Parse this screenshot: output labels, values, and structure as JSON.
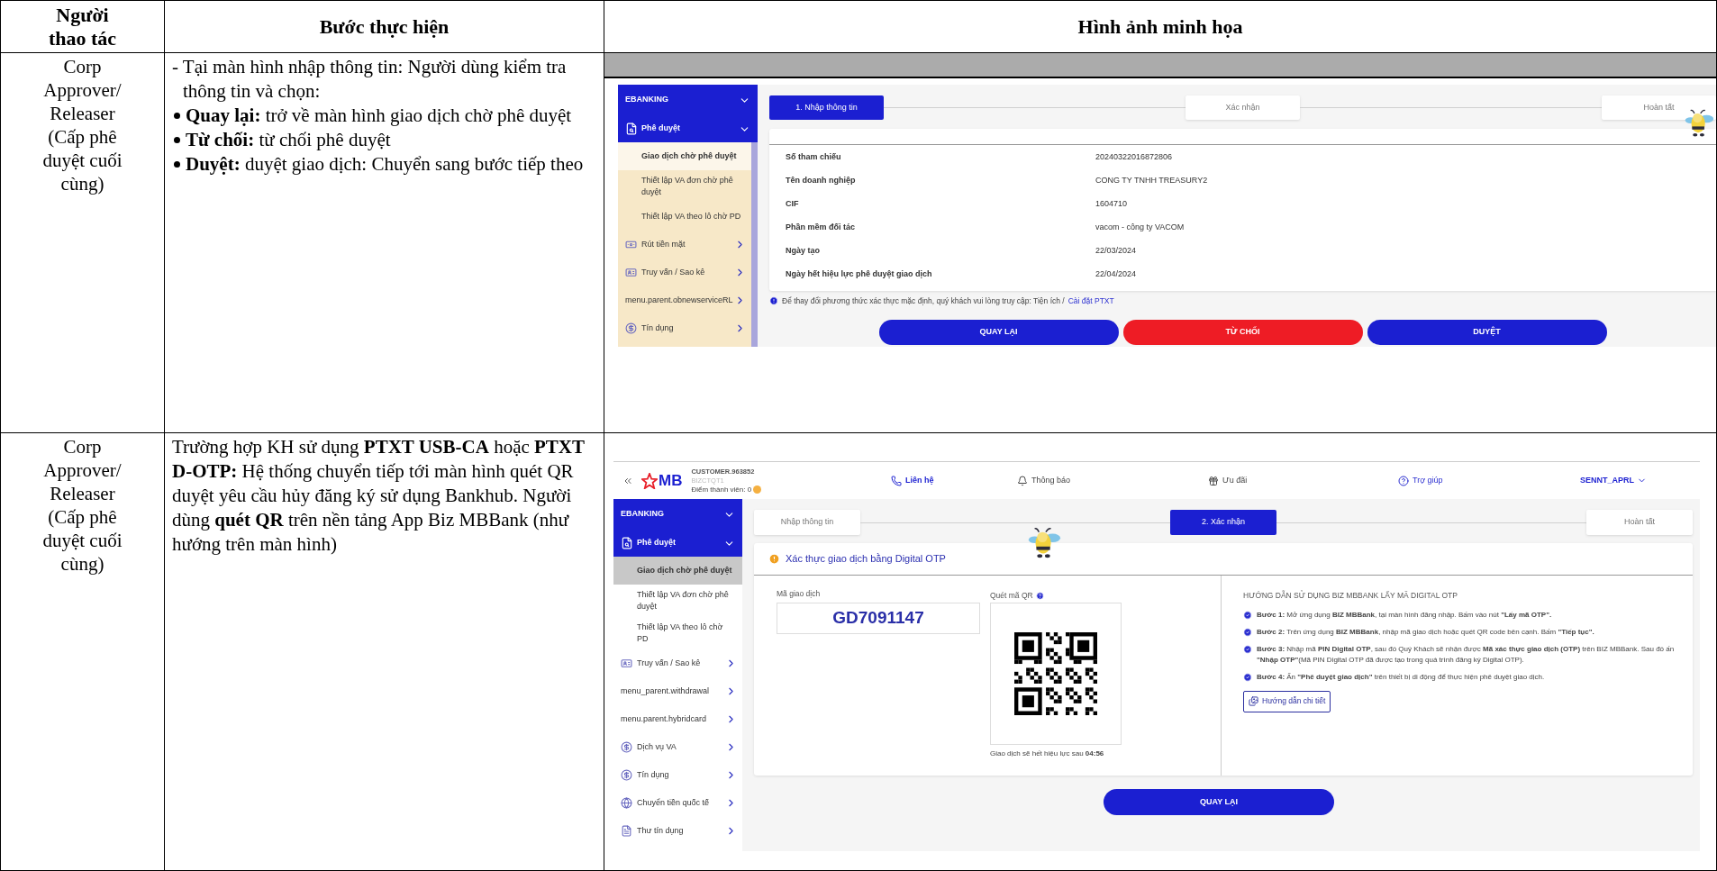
{
  "table": {
    "columns": [
      "Người thao tác",
      "Bước thực hiện",
      "Hình ảnh minh họa"
    ],
    "rows": [
      {
        "actor": "Corp Approver/ Releaser (Cấp phê duyệt cuối cùng)",
        "steps": {
          "intro": "- Tại màn hình nhập thông tin: Người dùng kiểm tra thông tin và chọn:",
          "bullets": [
            "**Quay lại:** trở về màn hình giao dịch chờ phê duyệt",
            "**Từ chối:** từ chối phê duyệt",
            "**Duyệt:** duyệt giao dịch: Chuyển sang bước tiếp theo"
          ]
        },
        "screenshot": {
          "kind": "review",
          "sidebar": {
            "section": "EBANKING",
            "group": "Phê duyệt",
            "items": [
              {
                "label": "Giao dịch chờ phê duyệt",
                "kind": "sub",
                "selected": true
              },
              {
                "label": "Thiết lập VA đơn chờ phê duyệt",
                "kind": "sub",
                "selected": false
              },
              {
                "label": "Thiết lập VA theo lô chờ PD",
                "kind": "sub",
                "selected": false
              },
              {
                "label": "Rút tiền mặt",
                "kind": "menu",
                "selected": false
              },
              {
                "label": "Truy vấn / Sao kê",
                "kind": "menu",
                "selected": false
              },
              {
                "label": "menu.parent.obnewserviceRL",
                "kind": "plain",
                "selected": false
              },
              {
                "label": "Tín dụng",
                "kind": "menu",
                "selected": false
              }
            ]
          },
          "stepper": [
            {
              "label": "1. Nhập thông tin",
              "selected": true
            },
            {
              "label": "Xác nhận",
              "selected": false
            },
            {
              "label": "Hoàn tất",
              "selected": false
            }
          ],
          "details": [
            {
              "label": "Số tham chiếu",
              "value": "20240322016872806"
            },
            {
              "label": "Tên doanh nghiệp",
              "value": "CONG TY TNHH TREASURY2"
            },
            {
              "label": "CIF",
              "value": "1604710"
            },
            {
              "label": "Phần mềm đối tác",
              "value": "vacom - công ty VACOM"
            },
            {
              "label": "Ngày tạo",
              "value": "22/03/2024"
            },
            {
              "label": "Ngày hết hiệu lực phê duyệt giao dịch",
              "value": "22/04/2024"
            }
          ],
          "note": {
            "text": "Để thay đổi phương thức xác thực mặc định, quý khách vui lòng truy cập: Tiện ích /",
            "link": "Cài đặt PTXT"
          },
          "buttons": [
            {
              "label": "QUAY LẠI",
              "kind": "primary"
            },
            {
              "label": "TỪ CHỐI",
              "kind": "danger"
            },
            {
              "label": "DUYỆT",
              "kind": "primary"
            }
          ]
        }
      },
      {
        "actor": "Corp Approver/ Releaser (Cấp phê duyệt cuối cùng)",
        "steps": {
          "paragraph": "Trường hợp KH sử dụng **PTXT USB-CA** hoặc **PTXT D-OTP:** Hệ thống chuyển tiếp tới màn hình quét QR duyệt yêu cầu hủy đăng ký sử dụng Bankhub. Người dùng **quét QR** trên nền tảng App Biz MBBank (như hướng trên màn hình)"
        },
        "screenshot": {
          "kind": "otp",
          "header": {
            "logo": "MB",
            "customer": "CUSTOMER.963852",
            "company": "BIZCTQT1",
            "points": "Điểm thành viên: 0",
            "nav": [
              {
                "label": "Liên hệ",
                "kind": "contact"
              },
              {
                "label": "Thông báo",
                "kind": "notifications"
              },
              {
                "label": "Ưu đãi",
                "kind": "offers"
              },
              {
                "label": "Trợ giúp",
                "kind": "help"
              }
            ],
            "user": "SENNT_APRL"
          },
          "sidebar": {
            "section": "EBANKING",
            "group": "Phê duyệt",
            "items": [
              {
                "label": "Giao dịch chờ phê duyệt",
                "kind": "sub",
                "selected": true
              },
              {
                "label": "Thiết lập VA đơn chờ phê duyệt",
                "kind": "sub",
                "selected": false
              },
              {
                "label": "Thiết lập VA theo lô chờ PD",
                "kind": "sub",
                "selected": false
              },
              {
                "label": "Truy vấn / Sao kê",
                "kind": "menu",
                "selected": false
              },
              {
                "label": "menu_parent.withdrawal",
                "kind": "plain",
                "selected": false
              },
              {
                "label": "menu.parent.hybridcard",
                "kind": "plain",
                "selected": false
              },
              {
                "label": "Dịch vụ VA",
                "kind": "menu",
                "selected": false
              },
              {
                "label": "Tín dụng",
                "kind": "menu",
                "selected": false
              },
              {
                "label": "Chuyển tiền quốc tế",
                "kind": "menu",
                "selected": false
              },
              {
                "label": "Thư tín dụng",
                "kind": "menu",
                "selected": false
              }
            ]
          },
          "stepper": [
            {
              "label": "Nhập thông tin",
              "selected": false
            },
            {
              "label": "2. Xác nhận",
              "selected": true
            },
            {
              "label": "Hoàn tất",
              "selected": false
            }
          ],
          "card": {
            "title": "Xác thực giao dịch bằng Digital OTP",
            "code_label": "Mã giao dịch",
            "code": "GD7091147",
            "qr_label": "Quét mã QR",
            "expiry": "Giao dịch sẽ hết hiệu lực sau **04:56**",
            "guide_title": "HƯỚNG DẪN SỬ DỤNG BIZ MBBANK LẤY MÃ DIGITAL OTP",
            "guide_steps": [
              "**Bước 1:** Mở ứng dụng **BIZ MBBank**, tại màn hình đăng nhập. Bấm vào nút **\"Lấy mã OTP\".**",
              "**Bước 2:** Trên ứng dụng **BIZ MBBank**, nhập mã giao dịch hoặc quét QR code bên cạnh. Bấm **\"Tiếp tục\".**",
              "**Bước 3:** Nhập mã **PIN Digital OTP**, sau đó Quý Khách sẽ nhận được **Mã xác thực giao dịch (OTP)** trên BIZ MBBank. Sau đó ấn **\"Nhập OTP\"**(Mã PIN Digital OTP đã được tạo trong quá trình đăng ký Digital OTP).",
              "**Bước 4:** Ấn **\"Phê duyệt giao dịch\"** trên thiết bị di động để thực hiện phê duyệt giao dịch."
            ],
            "guide_button": "Hướng dẫn chi tiết"
          },
          "buttons": [
            {
              "label": "QUAY LẠI",
              "kind": "primary"
            }
          ]
        }
      }
    ]
  }
}
